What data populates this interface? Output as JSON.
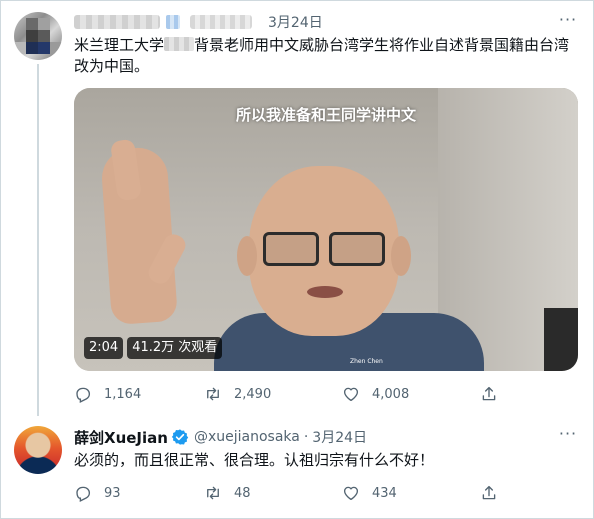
{
  "tweet": {
    "date": "3月24日",
    "text_part1": "米兰理工大学",
    "text_part2": "背景老师用中文威胁台湾学生将作业自述背景国籍由台湾改为中国。",
    "more_glyph": "···",
    "video": {
      "caption": "所以我准备和王同学讲中文",
      "duration": "2:04",
      "views": "41.2万 次观看",
      "participant_name": "Zhen Chen"
    },
    "actions": {
      "replies": "1,164",
      "retweets": "2,490",
      "likes": "4,008"
    }
  },
  "reply": {
    "display_name": "薛剑XueJian",
    "handle": "@xuejianosaka",
    "separator": "·",
    "date": "3月24日",
    "more_glyph": "···",
    "text": "必须的，而且很正常、很合理。认祖归宗有什么不好！",
    "actions": {
      "replies": "93",
      "retweets": "48",
      "likes": "434"
    }
  },
  "icons": [
    "reply-icon",
    "retweet-icon",
    "like-icon",
    "share-icon",
    "verified-badge-icon",
    "more-icon"
  ],
  "colors": {
    "text_primary": "#0f1419",
    "text_secondary": "#536471",
    "verified": "#1d9bf0",
    "border": "#cfd9de"
  }
}
